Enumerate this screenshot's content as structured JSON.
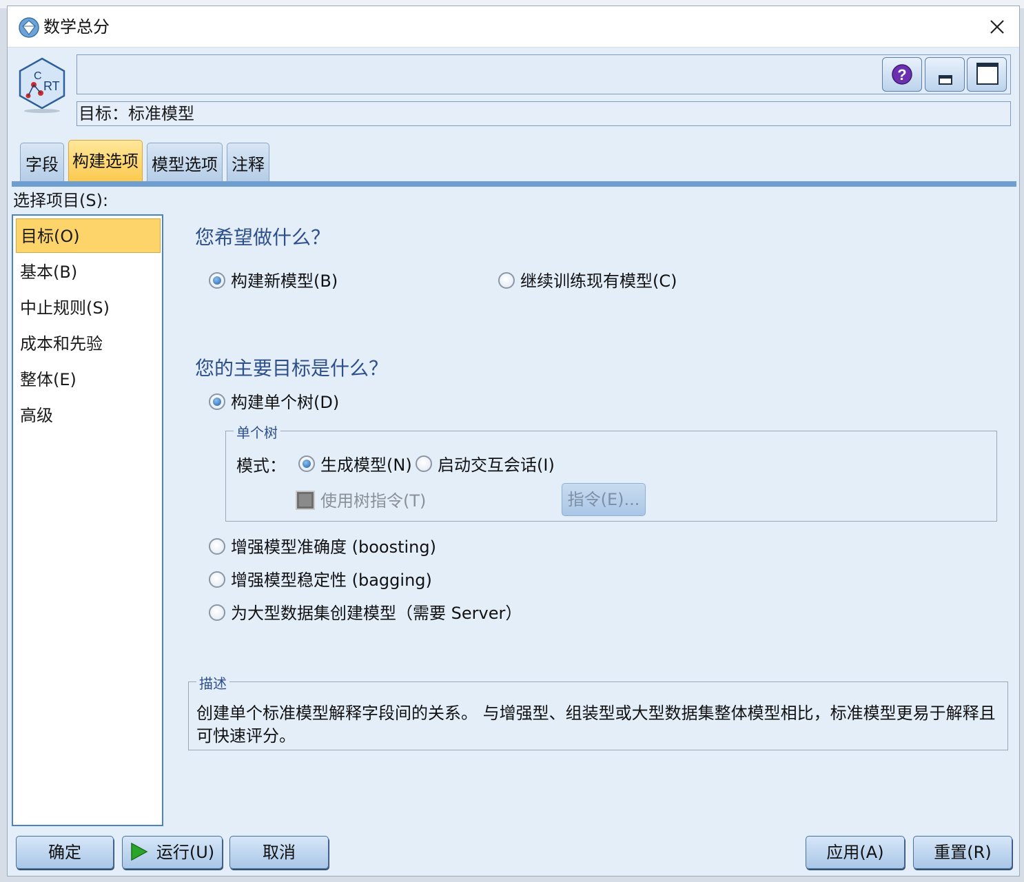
{
  "window": {
    "title": "数学总分",
    "close_symbol": "✕"
  },
  "header": {
    "node_icon": "crt-node-icon",
    "name_value": "",
    "target_label": "目标：标准模型",
    "buttons": [
      "help-icon",
      "minimize-icon",
      "maximize-icon"
    ]
  },
  "tabs": [
    {
      "label": "字段",
      "active": false
    },
    {
      "label": "构建选项",
      "active": true
    },
    {
      "label": "模型选项",
      "active": false
    },
    {
      "label": "注释",
      "active": false
    }
  ],
  "sidebar": {
    "label": "选择项目(S):",
    "items": [
      {
        "label": "目标(O)",
        "selected": true
      },
      {
        "label": "基本(B)",
        "selected": false
      },
      {
        "label": "中止规则(S)",
        "selected": false
      },
      {
        "label": "成本和先验",
        "selected": false
      },
      {
        "label": "整体(E)",
        "selected": false
      },
      {
        "label": "高级",
        "selected": false
      }
    ]
  },
  "objectives": {
    "q1": "您希望做什么？",
    "build_new": "构建新模型(B)",
    "continue_training": "继续训练现有模型(C)",
    "q2": "您的主要目标是什么？",
    "single_tree": "构建单个树(D)",
    "single_tree_group": {
      "legend": "单个树",
      "mode_label": "模式：",
      "generate_model": "生成模型(N)",
      "interactive_session": "启动交互会话(I)",
      "use_tree_directives": "使用树指令(T)",
      "directives_button": "指令(E)..."
    },
    "boosting": "增强模型准确度 (boosting)",
    "bagging": "增强模型稳定性 (bagging)",
    "large_dataset": "为大型数据集创建模型（需要 Server）",
    "selected": {
      "build": "build_new",
      "goal": "single_tree",
      "mode": "generate_model"
    },
    "use_tree_directives_checked": false
  },
  "description": {
    "legend": "描述",
    "text": "创建单个标准模型解释字段间的关系。 与增强型、组装型或大型数据集整体模型相比，标准模型更易于解释且可快速评分。"
  },
  "footer": {
    "ok": "确定",
    "run": "运行(U)",
    "cancel": "取消",
    "apply": "应用(A)",
    "reset": "重置(R)"
  },
  "colors": {
    "accent_tab": "#fbc94d",
    "window_bg": "#e4eef9",
    "section_title": "#2d4f8a",
    "run_green": "#2aa52a"
  }
}
